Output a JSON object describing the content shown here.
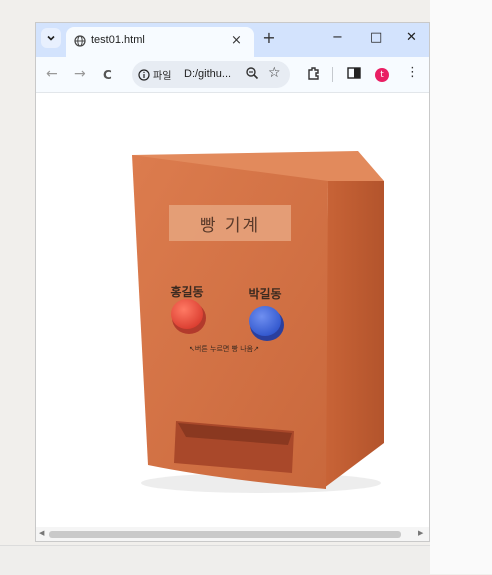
{
  "tab": {
    "title": "test01.html",
    "close": "×",
    "new_tab": "+"
  },
  "window_controls": {
    "minimize": "−",
    "maximize": "□",
    "close": "✕"
  },
  "nav": {
    "back": "←",
    "forward": "→",
    "reload": "C"
  },
  "omnibox": {
    "chip_label": "파일",
    "url": "D:/githu...",
    "star": "☆"
  },
  "toolbar": {
    "profile_initial": "t",
    "menu": "⋮"
  },
  "page": {
    "sign_text": "빵 기계",
    "left_button_label": "홍길동",
    "right_button_label": "박길동",
    "caption": "↖버튼 누르면 빵 나옴↗"
  },
  "colors": {
    "machine": "#d8784a",
    "left_button": "#e8463a",
    "right_button": "#3b63d8"
  }
}
